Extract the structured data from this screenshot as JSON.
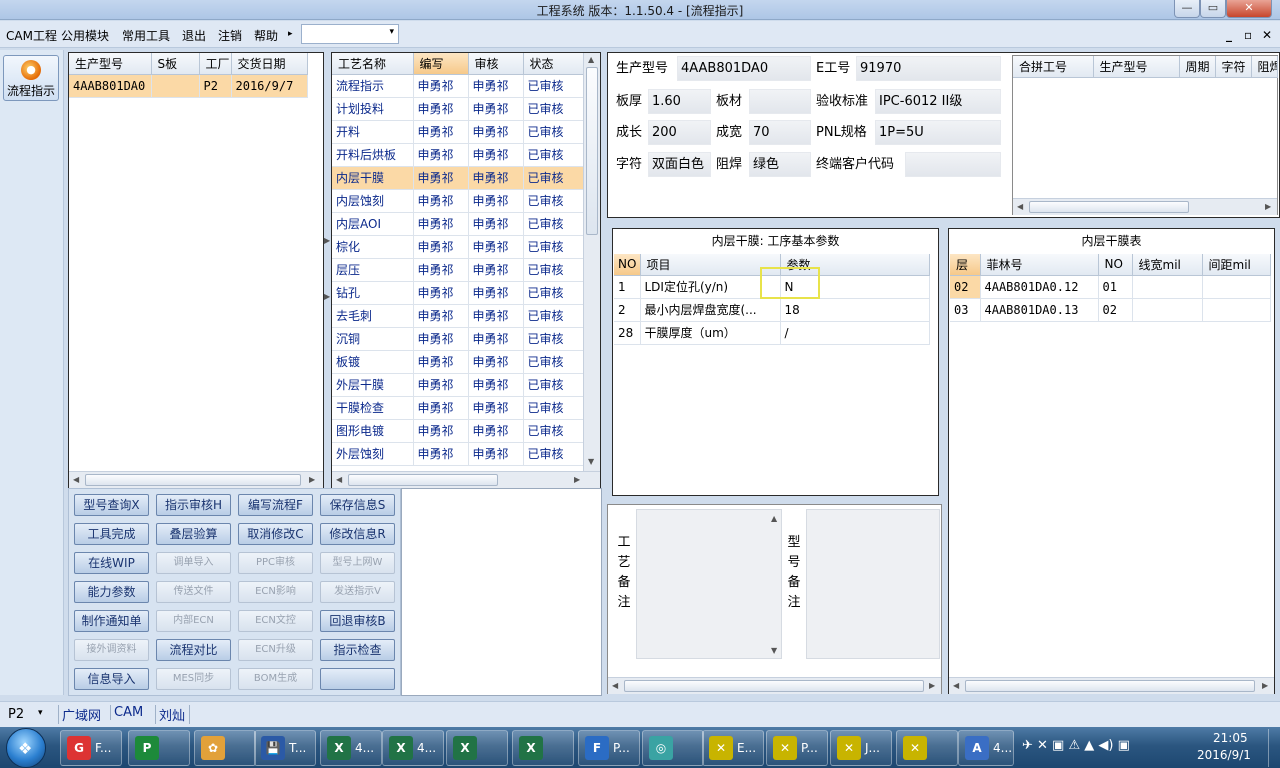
{
  "window": {
    "title": "工程系统  版本：1.1.50.4 - [流程指示]",
    "min": "—",
    "max": "▭",
    "close": "✕"
  },
  "menu": {
    "items": [
      "CAM工程",
      "公用模块",
      "常用工具",
      "退出",
      "注销",
      "帮助"
    ],
    "help_arrow": "▸",
    "combo_arrow": "▾",
    "mdi_min": "_",
    "mdi_restore": "▫",
    "mdi_close": "✕"
  },
  "leftbar": {
    "flow_label": "流程指示"
  },
  "orders": {
    "columns": [
      "生产型号",
      "S板",
      "工厂",
      "交货日期"
    ],
    "rows": [
      {
        "model": "4AAB801DA0",
        "s": "",
        "factory": "P2",
        "date": "2016/9/7"
      }
    ]
  },
  "process": {
    "columns": [
      "工艺名称",
      "编写",
      "审核",
      "状态"
    ],
    "rows": [
      [
        "流程指示",
        "申勇祁",
        "申勇祁",
        "已审核"
      ],
      [
        "计划投料",
        "申勇祁",
        "申勇祁",
        "已审核"
      ],
      [
        "开料",
        "申勇祁",
        "申勇祁",
        "已审核"
      ],
      [
        "开料后烘板",
        "申勇祁",
        "申勇祁",
        "已审核"
      ],
      [
        "内层干膜",
        "申勇祁",
        "申勇祁",
        "已审核"
      ],
      [
        "内层蚀刻",
        "申勇祁",
        "申勇祁",
        "已审核"
      ],
      [
        "内层AOI",
        "申勇祁",
        "申勇祁",
        "已审核"
      ],
      [
        "棕化",
        "申勇祁",
        "申勇祁",
        "已审核"
      ],
      [
        "层压",
        "申勇祁",
        "申勇祁",
        "已审核"
      ],
      [
        "钻孔",
        "申勇祁",
        "申勇祁",
        "已审核"
      ],
      [
        "去毛刺",
        "申勇祁",
        "申勇祁",
        "已审核"
      ],
      [
        "沉铜",
        "申勇祁",
        "申勇祁",
        "已审核"
      ],
      [
        "板镀",
        "申勇祁",
        "申勇祁",
        "已审核"
      ],
      [
        "外层干膜",
        "申勇祁",
        "申勇祁",
        "已审核"
      ],
      [
        "干膜检查",
        "申勇祁",
        "申勇祁",
        "已审核"
      ],
      [
        "图形电镀",
        "申勇祁",
        "申勇祁",
        "已审核"
      ],
      [
        "外层蚀刻",
        "申勇祁",
        "申勇祁",
        "已审核"
      ]
    ],
    "selected": 4
  },
  "buttons": [
    {
      "label": "型号查询X",
      "enabled": true
    },
    {
      "label": "指示审核H",
      "enabled": true
    },
    {
      "label": "编写流程F",
      "enabled": true
    },
    {
      "label": "保存信息S",
      "enabled": true
    },
    {
      "label": "工具完成",
      "enabled": true
    },
    {
      "label": "叠层验算",
      "enabled": true
    },
    {
      "label": "取消修改C",
      "enabled": true
    },
    {
      "label": "修改信息R",
      "enabled": true
    },
    {
      "label": "在线WIP",
      "enabled": true
    },
    {
      "label": "调单导入",
      "enabled": false
    },
    {
      "label": "PPC审核",
      "enabled": false
    },
    {
      "label": "型号上网W",
      "enabled": false
    },
    {
      "label": "能力参数",
      "enabled": true
    },
    {
      "label": "传送文件",
      "enabled": false
    },
    {
      "label": "ECN影响",
      "enabled": false
    },
    {
      "label": "发送指示V",
      "enabled": false
    },
    {
      "label": "制作通知单",
      "enabled": true
    },
    {
      "label": "内部ECN",
      "enabled": false
    },
    {
      "label": "ECN文控",
      "enabled": false
    },
    {
      "label": "回退审核B",
      "enabled": true
    },
    {
      "label": "接外调资料",
      "enabled": false
    },
    {
      "label": "流程对比",
      "enabled": true
    },
    {
      "label": "ECN升级",
      "enabled": false
    },
    {
      "label": "指示检查",
      "enabled": true
    },
    {
      "label": "信息导入",
      "enabled": true
    },
    {
      "label": "MES同步",
      "enabled": false
    },
    {
      "label": "BOM生成",
      "enabled": false
    },
    {
      "label": "",
      "enabled": true
    }
  ],
  "info": {
    "model_label": "生产型号",
    "model": "4AAB801DA0",
    "e_label": "E工号",
    "e_value": "91970",
    "thick_label": "板厚",
    "thick": "1.60",
    "material_label": "板材",
    "material": "",
    "std_label": "验收标准",
    "std": "IPC-6012 II级",
    "len_label": "成长",
    "len": "200",
    "width_label": "成宽",
    "width": "70",
    "pnl_label": "PNL规格",
    "pnl": "1P=5U",
    "char_label": "字符",
    "char": "双面白色",
    "mask_label": "阻焊",
    "mask": "绿色",
    "cust_label": "终端客户代码",
    "cust": ""
  },
  "merge": {
    "columns": [
      "合拼工号",
      "生产型号",
      "周期",
      "字符",
      "阻焊"
    ]
  },
  "params": {
    "title": "内层干膜: 工序基本参数",
    "columns": [
      "NO",
      "项目",
      "参数"
    ],
    "rows": [
      [
        "1",
        "LDI定位孔(y/n)",
        "N"
      ],
      [
        "2",
        "最小内层焊盘宽度(...",
        "18"
      ],
      [
        "28",
        "干膜厚度（um）",
        "/"
      ]
    ]
  },
  "film": {
    "title": "内层干膜表",
    "columns": [
      "层",
      "菲林号",
      "NO",
      "线宽mil",
      "间距mil"
    ],
    "rows": [
      [
        "02",
        "4AAB801DA0.12",
        "01",
        "",
        ""
      ],
      [
        "03",
        "4AAB801DA0.13",
        "02",
        "",
        ""
      ]
    ]
  },
  "notes": {
    "process_label": [
      "工",
      "艺",
      "备",
      "注"
    ],
    "model_label": [
      "型",
      "号",
      "备",
      "注"
    ]
  },
  "status": {
    "factory": "P2",
    "items": [
      "广域网",
      "CAM",
      "刘灿"
    ]
  },
  "taskbar": {
    "items": [
      "F...",
      "",
      "",
      "T...",
      "4...",
      "4...",
      "",
      "",
      "P...",
      "",
      "E...",
      "P...",
      "J...",
      "",
      "4..."
    ],
    "time": "21:05",
    "date": "2016/9/1"
  }
}
